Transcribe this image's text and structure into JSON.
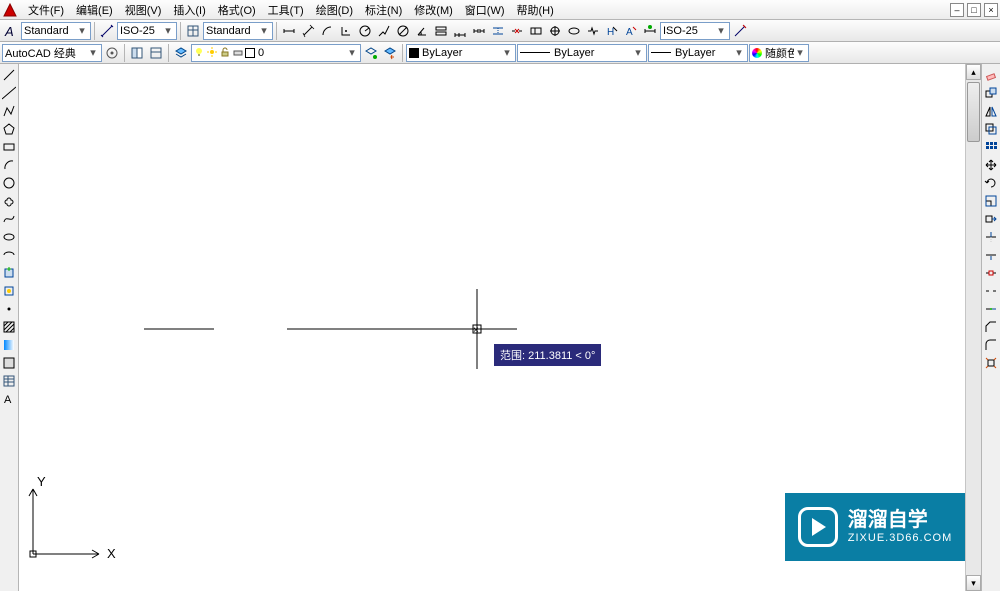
{
  "menu": {
    "items": [
      "文件(F)",
      "编辑(E)",
      "视图(V)",
      "插入(I)",
      "格式(O)",
      "工具(T)",
      "绘图(D)",
      "标注(N)",
      "修改(M)",
      "窗口(W)",
      "帮助(H)"
    ]
  },
  "toolbar1": {
    "textstyle": {
      "value": "Standard"
    },
    "dimstyle1": {
      "value": "ISO-25"
    },
    "tablestyle": {
      "value": "Standard"
    },
    "dimstyle2": {
      "value": "ISO-25"
    }
  },
  "toolbar2": {
    "workspace": {
      "value": "AutoCAD 经典"
    },
    "layer": {
      "value": "0"
    },
    "color": {
      "value": "ByLayer"
    },
    "linetype": {
      "value": "ByLayer"
    },
    "lineweight": {
      "value": "ByLayer"
    },
    "plotstyle": {
      "value": "随颜色"
    }
  },
  "drawing": {
    "dynamic_input": "范围: 211.3811 < 0°",
    "ucs_x": "X",
    "ucs_y": "Y"
  },
  "watermark": {
    "title": "溜溜自学",
    "url": "ZIXUE.3D66.COM"
  }
}
